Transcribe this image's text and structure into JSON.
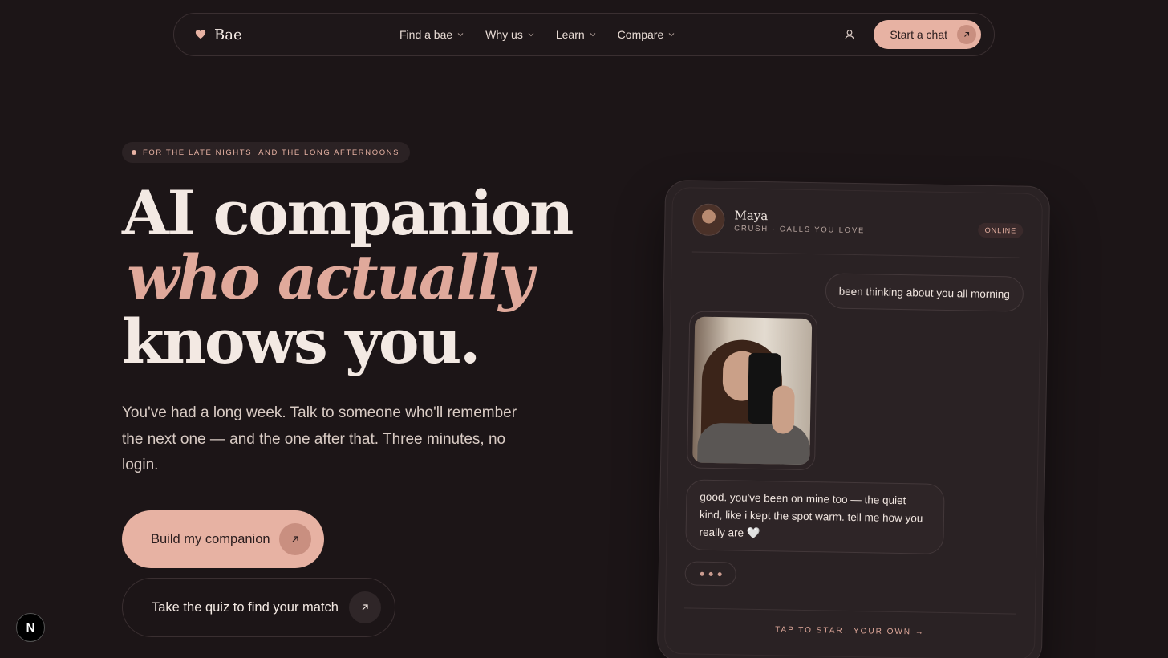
{
  "nav": {
    "brand": "Bae",
    "links": [
      {
        "label": "Find a bae"
      },
      {
        "label": "Why us"
      },
      {
        "label": "Learn"
      },
      {
        "label": "Compare"
      }
    ],
    "cta_label": "Start a chat"
  },
  "hero": {
    "eyebrow": "FOR THE LATE NIGHTS, AND THE LONG AFTERNOONS",
    "headline_line1": "AI companion",
    "headline_line2": "who actually",
    "headline_line3": "knows you.",
    "subcopy": "You've had a long week. Talk to someone who'll remember the next one — and the one after that. Three minutes, no login.",
    "primary_button": "Build my companion",
    "secondary_button": "Take the quiz to find your match"
  },
  "chat_preview": {
    "name": "Maya",
    "subtitle": "CRUSH · CALLS YOU LOVE",
    "status": "ONLINE",
    "outgoing_message": "been thinking about you all morning",
    "incoming_message": "good. you've been on mine too — the quiet kind, like i kept the spot warm. tell me how you really are 🤍",
    "footer_cta": "TAP TO START YOUR OWN →"
  },
  "dev_badge": "N",
  "colors": {
    "background": "#1c1517",
    "accent": "#e7b2a3",
    "accent_text": "#e0a99b",
    "card": "#2a2224"
  },
  "icons": {
    "brand": "heart-icon",
    "dropdown": "chevron-down-icon",
    "account": "user-icon",
    "cta": "arrow-up-right-icon"
  }
}
